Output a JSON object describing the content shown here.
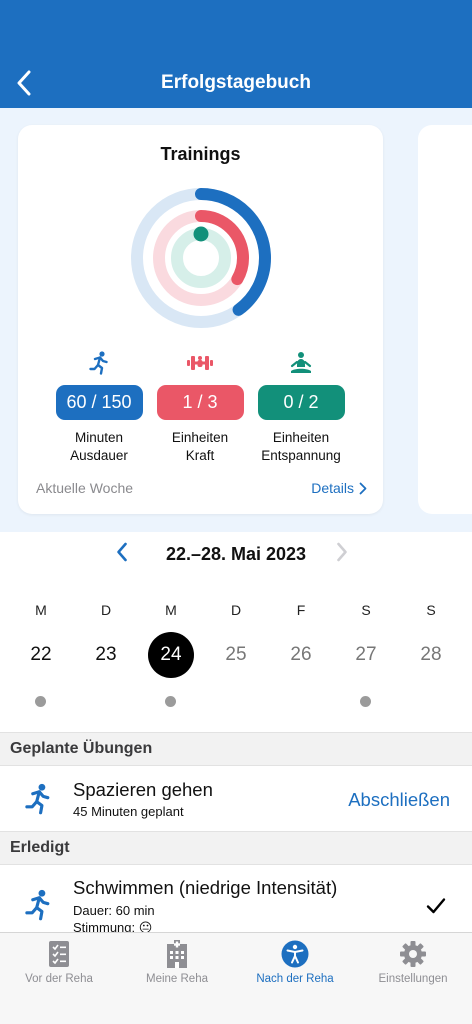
{
  "header": {
    "title": "Erfolgstagebuch"
  },
  "trainings_card": {
    "title": "Trainings",
    "rings": [
      {
        "name": "Ausdauer",
        "value": 60,
        "goal": 150,
        "color": "#1d6fc0",
        "track": "#d9e7f5"
      },
      {
        "name": "Kraft",
        "value": 1,
        "goal": 3,
        "color": "#ea5767",
        "track": "#fadadf"
      },
      {
        "name": "Entspannung",
        "value": 0,
        "goal": 2,
        "color": "#12907a",
        "track": "#d6efe9"
      }
    ],
    "stats": [
      {
        "value": "60 / 150",
        "label_1": "Minuten",
        "label_2": "Ausdauer",
        "color": "#1d6fc0",
        "icon": "running-icon"
      },
      {
        "value": "1 / 3",
        "label_1": "Einheiten",
        "label_2": "Kraft",
        "color": "#ea5767",
        "icon": "dumbbell-icon"
      },
      {
        "value": "0 / 2",
        "label_1": "Einheiten",
        "label_2": "Entspannung",
        "color": "#12907a",
        "icon": "meditation-icon"
      }
    ],
    "footer_label": "Aktuelle Woche",
    "details_label": "Details"
  },
  "week": {
    "range": "22.–28. Mai 2023",
    "days": [
      {
        "letter": "M",
        "number": "22",
        "state": "past",
        "dot": true
      },
      {
        "letter": "D",
        "number": "23",
        "state": "past",
        "dot": false
      },
      {
        "letter": "M",
        "number": "24",
        "state": "selected",
        "dot": true
      },
      {
        "letter": "D",
        "number": "25",
        "state": "future",
        "dot": false
      },
      {
        "letter": "F",
        "number": "26",
        "state": "future",
        "dot": false
      },
      {
        "letter": "S",
        "number": "27",
        "state": "future",
        "dot": true
      },
      {
        "letter": "S",
        "number": "28",
        "state": "future",
        "dot": false
      }
    ]
  },
  "planned": {
    "heading": "Geplante Übungen",
    "item": {
      "title": "Spazieren gehen",
      "subtitle": "45 Minuten geplant",
      "action": "Abschließen"
    }
  },
  "done": {
    "heading": "Erledigt",
    "item": {
      "title": "Schwimmen (niedrige Intensität)",
      "duration": "Dauer: 60 min",
      "mood": "Stimmung: 😐"
    }
  },
  "tabbar": {
    "tabs": [
      {
        "label": "Vor der Reha",
        "icon": "checklist-icon",
        "active": false
      },
      {
        "label": "Meine Reha",
        "icon": "hospital-icon",
        "active": false
      },
      {
        "label": "Nach der Reha",
        "icon": "accessibility-icon",
        "active": true
      },
      {
        "label": "Einstellungen",
        "icon": "gear-icon",
        "active": false
      }
    ]
  },
  "colors": {
    "brand": "#1d6fc0",
    "strength": "#ea5767",
    "relax": "#12907a"
  }
}
